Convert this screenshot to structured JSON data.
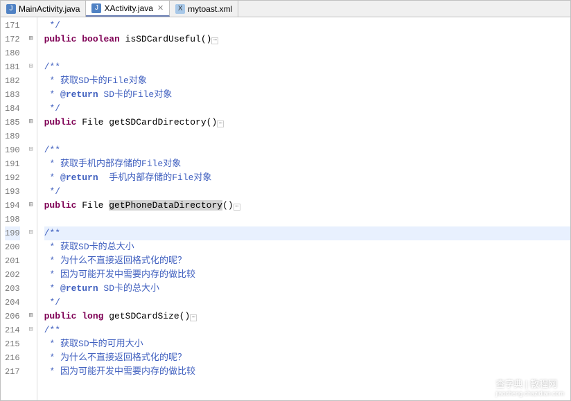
{
  "tabs": [
    {
      "label": "MainActivity.java",
      "icon": "J",
      "type": "java"
    },
    {
      "label": "XActivity.java",
      "icon": "J",
      "type": "java"
    },
    {
      "label": "mytoast.xml",
      "icon": "X",
      "type": "xml"
    }
  ],
  "code": {
    "lines": [
      {
        "num": "171",
        "fold": "",
        "segs": [
          {
            "cls": "comment",
            "t": " */"
          }
        ]
      },
      {
        "num": "172",
        "fold": "collapsed",
        "segs": [
          {
            "cls": "kw",
            "t": "public"
          },
          {
            "cls": "",
            "t": " "
          },
          {
            "cls": "kw",
            "t": "boolean"
          },
          {
            "cls": "",
            "t": " isSDCardUseful()"
          }
        ],
        "folded": true
      },
      {
        "num": "180",
        "fold": "",
        "segs": []
      },
      {
        "num": "181",
        "fold": "expanded",
        "segs": [
          {
            "cls": "comment",
            "t": "/**"
          }
        ]
      },
      {
        "num": "182",
        "fold": "",
        "segs": [
          {
            "cls": "comment",
            "t": " * 获取SD卡的File对象"
          }
        ]
      },
      {
        "num": "183",
        "fold": "",
        "segs": [
          {
            "cls": "comment",
            "t": " * "
          },
          {
            "cls": "comment-tag",
            "t": "@return"
          },
          {
            "cls": "comment",
            "t": " SD卡的File对象"
          }
        ]
      },
      {
        "num": "184",
        "fold": "",
        "segs": [
          {
            "cls": "comment",
            "t": " */"
          }
        ]
      },
      {
        "num": "185",
        "fold": "collapsed",
        "segs": [
          {
            "cls": "kw",
            "t": "public"
          },
          {
            "cls": "",
            "t": " File getSDCardDirectory()"
          }
        ],
        "folded": true
      },
      {
        "num": "189",
        "fold": "",
        "segs": []
      },
      {
        "num": "190",
        "fold": "expanded",
        "segs": [
          {
            "cls": "comment",
            "t": "/**"
          }
        ]
      },
      {
        "num": "191",
        "fold": "",
        "segs": [
          {
            "cls": "comment",
            "t": " * 获取手机内部存储的File对象"
          }
        ]
      },
      {
        "num": "192",
        "fold": "",
        "segs": [
          {
            "cls": "comment",
            "t": " * "
          },
          {
            "cls": "comment-tag",
            "t": "@return"
          },
          {
            "cls": "comment",
            "t": "  手机内部存储的File对象"
          }
        ]
      },
      {
        "num": "193",
        "fold": "",
        "segs": [
          {
            "cls": "comment",
            "t": " */"
          }
        ]
      },
      {
        "num": "194",
        "fold": "collapsed",
        "segs": [
          {
            "cls": "kw",
            "t": "public"
          },
          {
            "cls": "",
            "t": " File "
          },
          {
            "cls": "method-hl",
            "t": "getPhoneDataDirectory"
          },
          {
            "cls": "",
            "t": "()"
          }
        ],
        "folded": true
      },
      {
        "num": "198",
        "fold": "",
        "segs": []
      },
      {
        "num": "199",
        "fold": "expanded",
        "highlight": true,
        "segs": [
          {
            "cls": "comment",
            "t": "/**"
          }
        ]
      },
      {
        "num": "200",
        "fold": "",
        "segs": [
          {
            "cls": "comment",
            "t": " * 获取SD卡的总大小"
          }
        ]
      },
      {
        "num": "201",
        "fold": "",
        "segs": [
          {
            "cls": "comment",
            "t": " * 为什么不直接返回格式化的呢？"
          }
        ]
      },
      {
        "num": "202",
        "fold": "",
        "segs": [
          {
            "cls": "comment",
            "t": " * 因为可能开发中需要内存的做比较"
          }
        ]
      },
      {
        "num": "203",
        "fold": "",
        "segs": [
          {
            "cls": "comment",
            "t": " * "
          },
          {
            "cls": "comment-tag",
            "t": "@return"
          },
          {
            "cls": "comment",
            "t": " SD卡的总大小"
          }
        ]
      },
      {
        "num": "204",
        "fold": "",
        "segs": [
          {
            "cls": "comment",
            "t": " */"
          }
        ]
      },
      {
        "num": "206",
        "fold": "collapsed",
        "segs": [
          {
            "cls": "kw",
            "t": "public"
          },
          {
            "cls": "",
            "t": " "
          },
          {
            "cls": "kw",
            "t": "long"
          },
          {
            "cls": "",
            "t": " getSDCardSize()"
          }
        ],
        "folded": true
      },
      {
        "num": "214",
        "fold": "expanded",
        "segs": [
          {
            "cls": "comment",
            "t": "/**"
          }
        ]
      },
      {
        "num": "215",
        "fold": "",
        "segs": [
          {
            "cls": "comment",
            "t": " * 获取SD卡的可用大小"
          }
        ]
      },
      {
        "num": "216",
        "fold": "",
        "segs": [
          {
            "cls": "comment",
            "t": " * 为什么不直接返回格式化的呢？"
          }
        ]
      },
      {
        "num": "217",
        "fold": "",
        "segs": [
          {
            "cls": "comment",
            "t": " * 因为可能开发中需要内存的做比较"
          }
        ]
      }
    ]
  },
  "watermark": {
    "main": "查字典 | 教程网",
    "sub": "jiaocheng.chazidian.com"
  }
}
